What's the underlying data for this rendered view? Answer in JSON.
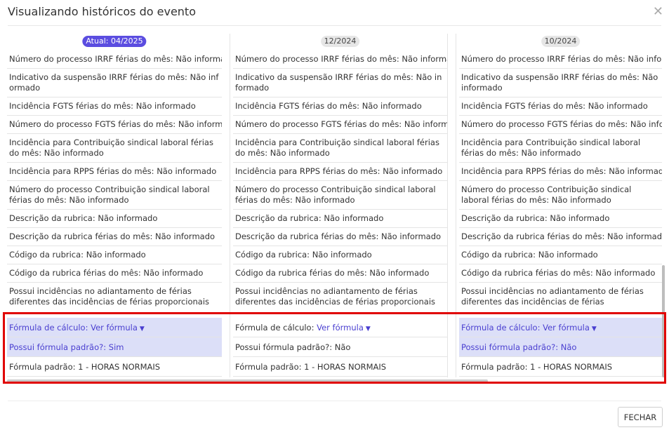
{
  "modal": {
    "title": "Visualizando históricos do evento",
    "close_icon": "close-icon",
    "close_button": "FECHAR"
  },
  "columns": [
    {
      "badge": "Atual: 04/2025",
      "current": true,
      "rows": [
        "Número do processo IRRF férias do mês: Não informado",
        "Indicativo da suspensão IRRF férias do mês: Não informado",
        "Incidência FGTS férias do mês: Não informado",
        "Número do processo FGTS férias do mês: Não informado",
        "Incidência para Contribuição sindical laboral férias do mês: Não informado",
        "Incidência para RPPS férias do mês: Não informado",
        "Número do processo Contribuição sindical laboral férias do mês: Não informado",
        "Descrição da rubrica: Não informado",
        "Descrição da rubrica férias do mês: Não informado",
        "Código da rubrica: Não informado",
        "Código da rubrica férias do mês: Não informado",
        "Possui incidências no adiantamento de férias diferentes das incidências de férias proporcionais do mês?: Não"
      ],
      "formula_label": "Fórmula de cálculo:",
      "formula_link": "Ver fórmula",
      "formula_highlight": true,
      "padrao_q": "Possui fórmula padrão?: Sim",
      "padrao_highlight": true,
      "padrao": "Fórmula padrão: 1 - HORAS NORMAIS"
    },
    {
      "badge": "12/2024",
      "current": false,
      "rows": [
        "Número do processo IRRF férias do mês: Não informado",
        "Indicativo da suspensão IRRF férias do mês: Não informado",
        "Incidência FGTS férias do mês: Não informado",
        "Número do processo FGTS férias do mês: Não informado",
        "Incidência para Contribuição sindical laboral férias do mês: Não informado",
        "Incidência para RPPS férias do mês: Não informado",
        "Número do processo Contribuição sindical laboral férias do mês: Não informado",
        "Descrição da rubrica: Não informado",
        "Descrição da rubrica férias do mês: Não informado",
        "Código da rubrica: Não informado",
        "Código da rubrica férias do mês: Não informado",
        "Possui incidências no adiantamento de férias diferentes das incidências de férias proporcionais do mês?: Não"
      ],
      "formula_label": "Fórmula de cálculo:",
      "formula_link": "Ver fórmula",
      "formula_highlight": false,
      "padrao_q": "Possui fórmula padrão?: Não",
      "padrao_highlight": false,
      "padrao": "Fórmula padrão: 1 - HORAS NORMAIS"
    },
    {
      "badge": "10/2024",
      "current": false,
      "rows": [
        "Número do processo IRRF férias do mês: Não informado",
        "Indicativo da suspensão IRRF férias do mês: Não informado",
        "Incidência FGTS férias do mês: Não informado",
        "Número do processo FGTS férias do mês: Não informado",
        "Incidência para Contribuição sindical laboral férias do mês: Não informado",
        "Incidência para RPPS férias do mês: Não informado",
        "Número do processo Contribuição sindical laboral férias do mês: Não informado",
        "Descrição da rubrica: Não informado",
        "Descrição da rubrica férias do mês: Não informado",
        "Código da rubrica: Não informado",
        "Código da rubrica férias do mês: Não informado",
        "Possui incidências no adiantamento de férias diferentes das incidências de férias proporcionais do mês?: Não"
      ],
      "formula_label": "Fórmula de cálculo:",
      "formula_link": "Ver fórmula",
      "formula_highlight": true,
      "padrao_q": "Possui fórmula padrão?: Não",
      "padrao_highlight": true,
      "padrao": "Fórmula padrão: 1 - HORAS NORMAIS"
    }
  ]
}
